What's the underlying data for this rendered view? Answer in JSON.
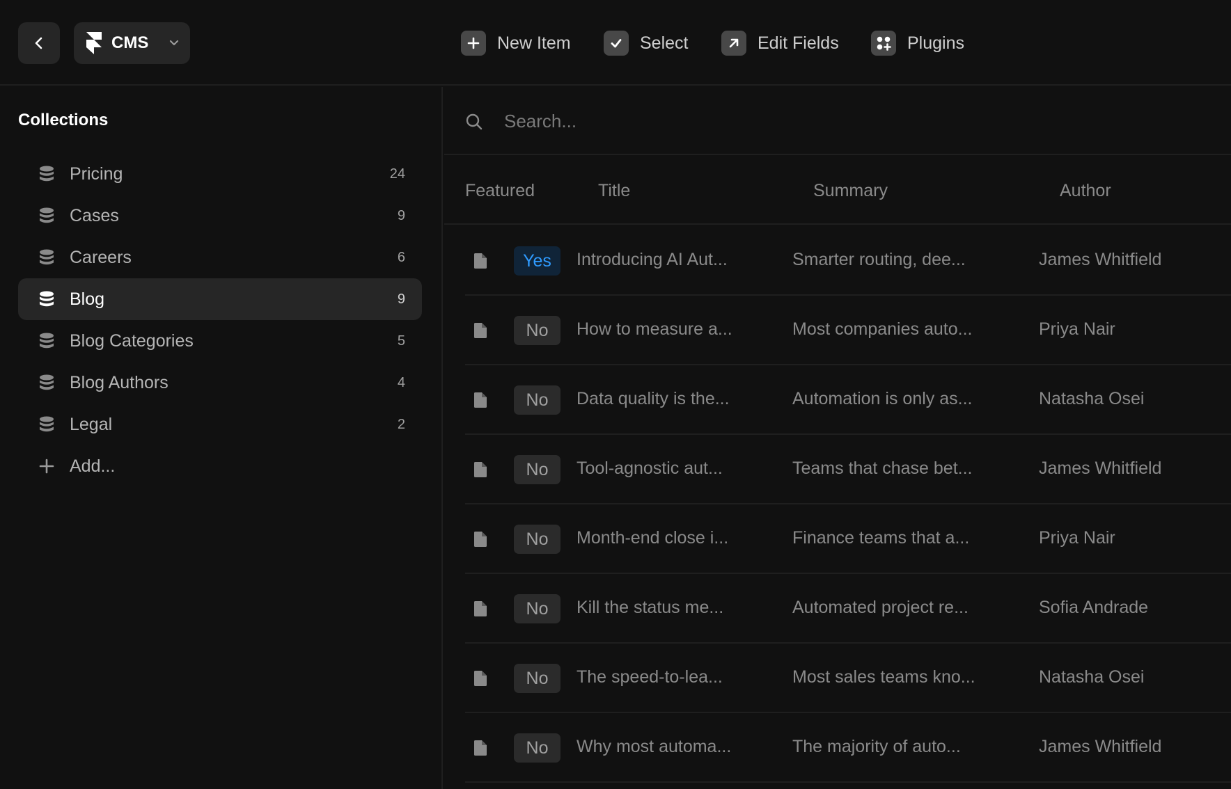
{
  "toolbar": {
    "cms_label": "CMS",
    "new_item_label": "New Item",
    "select_label": "Select",
    "edit_fields_label": "Edit Fields",
    "plugins_label": "Plugins"
  },
  "sidebar": {
    "title": "Collections",
    "items": [
      {
        "label": "Pricing",
        "count": "24"
      },
      {
        "label": "Cases",
        "count": "9"
      },
      {
        "label": "Careers",
        "count": "6"
      },
      {
        "label": "Blog",
        "count": "9"
      },
      {
        "label": "Blog Categories",
        "count": "5"
      },
      {
        "label": "Blog Authors",
        "count": "4"
      },
      {
        "label": "Legal",
        "count": "2"
      }
    ],
    "active_item": "Blog",
    "add_label": "Add..."
  },
  "search": {
    "placeholder": "Search..."
  },
  "table": {
    "columns": [
      "Featured",
      "Title",
      "Summary",
      "Author"
    ],
    "rows": [
      {
        "featured": "Yes",
        "title": "Introducing AI Aut...",
        "summary": "Smarter routing, dee...",
        "author": "James Whitfield"
      },
      {
        "featured": "No",
        "title": "How to measure a...",
        "summary": "Most companies auto...",
        "author": "Priya Nair"
      },
      {
        "featured": "No",
        "title": "Data quality is the...",
        "summary": "Automation is only as...",
        "author": "Natasha Osei"
      },
      {
        "featured": "No",
        "title": "Tool-agnostic aut...",
        "summary": "Teams that chase bet...",
        "author": "James Whitfield"
      },
      {
        "featured": "No",
        "title": "Month-end close i...",
        "summary": "Finance teams that a...",
        "author": "Priya Nair"
      },
      {
        "featured": "No",
        "title": "Kill the status me...",
        "summary": "Automated project re...",
        "author": "Sofia Andrade"
      },
      {
        "featured": "No",
        "title": "The speed-to-lea...",
        "summary": "Most sales teams kno...",
        "author": "Natasha Osei"
      },
      {
        "featured": "No",
        "title": "Why most automa...",
        "summary": "The majority of auto...",
        "author": "James Whitfield"
      }
    ]
  },
  "colors": {
    "background": "#111111",
    "panel": "#262626",
    "accent_blue": "#2f9bff",
    "featured_yes_bg": "#102438"
  }
}
